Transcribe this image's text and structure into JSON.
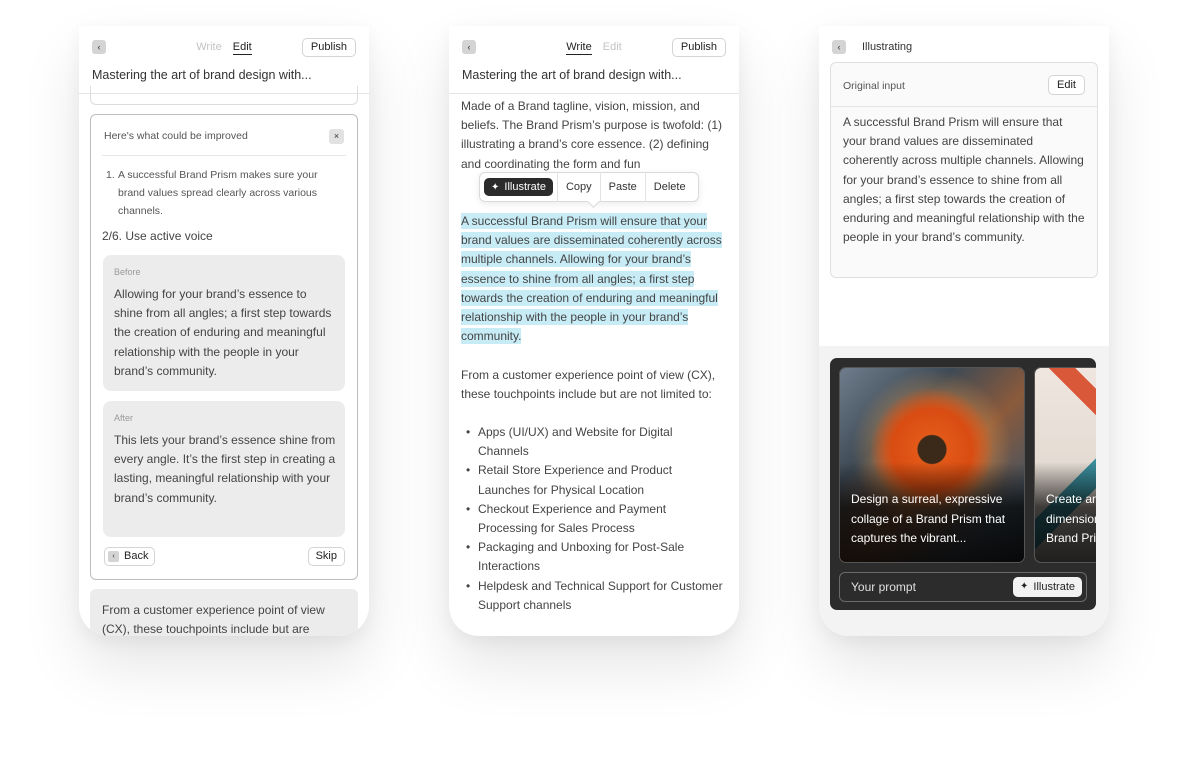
{
  "phone1": {
    "tabs": [
      "Write",
      "Edit"
    ],
    "publish_label": "Publish",
    "doc_title": "Mastering the art of brand design with...",
    "improve_heading": "Here's what could be improved",
    "close_glyph": "×",
    "suggestion_number": "1.",
    "suggestion_text": "A successful Brand Prism makes sure your brand values spread clearly across various channels.",
    "voice_step": "2/6. Use active voice",
    "before_label": "Before",
    "before_text": "Allowing for your brand’s essence to shine from all angles; a first step towards the creation of enduring and meaningful relationship with the people in your brand’s community.",
    "after_label": "After",
    "after_text": "This lets your brand’s essence shine from every angle. It’s the first step in creating a lasting, meaningful relationship with your brand’s community.",
    "back_label": "Back",
    "skip_label": "Skip",
    "bottom_text": "From a customer experience point of view (CX), these touchpoints include but are"
  },
  "phone2": {
    "tabs": [
      "Write",
      "Edit"
    ],
    "publish_label": "Publish",
    "doc_title": "Mastering the art of brand design with...",
    "para1": "Made of a Brand tagline, vision, mission, and beliefs. The Brand Prism’s purpose is twofold: (1) illustrating a brand’s core essence. (2) defining and coordinating the form and fun",
    "context_menu": {
      "illustrate": "Illustrate",
      "copy": "Copy",
      "paste": "Paste",
      "delete": "Delete"
    },
    "selected_text": "A successful Brand Prism will ensure that your brand values are disseminated coherently across multiple channels. Allowing for your brand’s essence to shine from all angles; a first step towards the creation of enduring and meaningful relationship with the people in your brand’s community.",
    "para3": "From a customer experience point of view (CX), these touchpoints include but are not limited to:",
    "bullets": [
      "Apps (UI/UX) and Website for Digital Channels",
      "Retail Store Experience and Product Launches for Physical Location",
      "Checkout Experience and Payment Processing for Sales Process",
      "Packaging and Unboxing for Post-Sale Interactions",
      "Helpdesk and Technical Support for Customer Support channels"
    ]
  },
  "phone3": {
    "title": "Illustrating",
    "original_label": "Original input",
    "edit_label": "Edit",
    "original_text": "A successful Brand Prism will ensure that your brand values are disseminated coherently across multiple channels. Allowing for your brand’s essence to shine from all angles; a first step towards the creation of enduring and meaningful relationship with the people in your brand’s community.",
    "cards": [
      {
        "caption": "Design a surreal, expressive collage of a Brand Prism that captures the vibrant..."
      },
      {
        "caption": "Create an abstract, multi-dimensional depiction of a Brand Prism..."
      }
    ],
    "prompt_placeholder": "Your prompt",
    "illustrate_label": "Illustrate"
  },
  "icons": {
    "back": "‹",
    "sparkle": "✦"
  }
}
